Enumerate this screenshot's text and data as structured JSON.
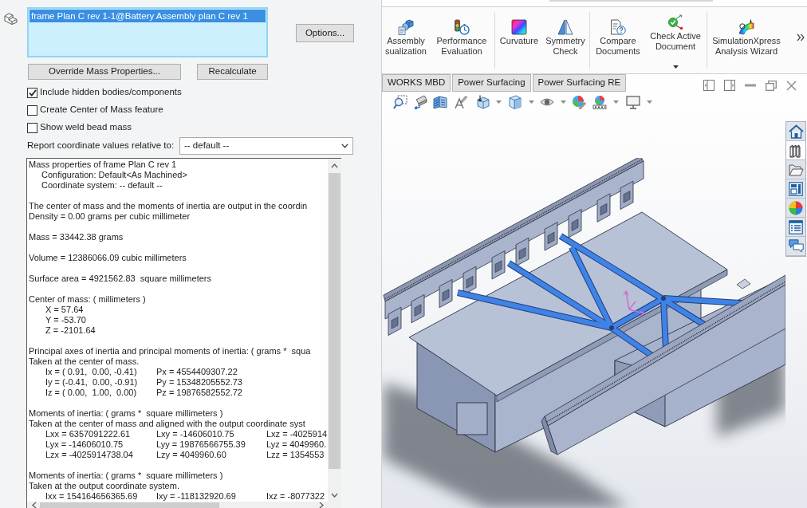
{
  "property_manager": {
    "selection_list": {
      "items": [
        {
          "text": "frame Plan C rev 1-1@Battery Assembly plan C rev 1",
          "selected": true
        }
      ]
    },
    "options_button": "Options...",
    "buttons": [
      "Override Mass Properties...",
      "Recalculate"
    ],
    "checkboxes": [
      {
        "label": "Include hidden bodies/components",
        "checked": true
      },
      {
        "label": "Create Center of Mass feature",
        "checked": false
      },
      {
        "label": "Show weld bead mass",
        "checked": false
      }
    ],
    "coordinate_select": {
      "label": "Report coordinate values relative to:",
      "value": "-- default --"
    },
    "report": {
      "blocks": [
        {
          "lines": [
            {
              "kind": "line",
              "text": "Mass properties of frame Plan C rev 1"
            },
            {
              "kind": "sub",
              "text": "Configuration: Default<As Machined>"
            },
            {
              "kind": "sub",
              "text": "Coordinate system: -- default --"
            }
          ]
        },
        {
          "lines": [
            {
              "kind": "line",
              "text": "The center of mass and the moments of inertia are output in the coordin"
            },
            {
              "kind": "line",
              "text": "Density = 0.00 grams per cubic millimeter"
            }
          ]
        },
        {
          "lines": [
            {
              "kind": "line",
              "text": "Mass = 33442.38 grams"
            }
          ]
        },
        {
          "lines": [
            {
              "kind": "line",
              "text": "Volume = 12386066.09 cubic millimeters"
            }
          ]
        },
        {
          "lines": [
            {
              "kind": "line",
              "text": "Surface area = 4921562.83  square millimeters"
            }
          ]
        },
        {
          "lines": [
            {
              "kind": "line",
              "text": "Center of mass: ( millimeters )"
            },
            {
              "kind": "cells",
              "cells": [
                "X = 57.64"
              ]
            },
            {
              "kind": "cells",
              "cells": [
                "Y = -53.70"
              ]
            },
            {
              "kind": "cells",
              "cells": [
                "Z = -2101.64"
              ]
            }
          ]
        },
        {
          "lines": [
            {
              "kind": "line",
              "text": "Principal axes of inertia and principal moments of inertia: ( grams *  squa"
            },
            {
              "kind": "line",
              "text": "Taken at the center of mass."
            },
            {
              "kind": "cells",
              "cells": [
                "Ix = ( 0.91,  0.00, -0.41)",
                "Px = 4554409307.22"
              ]
            },
            {
              "kind": "cells",
              "cells": [
                "Iy = (-0.41,  0.00, -0.91)",
                "Py = 15348205552.73"
              ]
            },
            {
              "kind": "cells",
              "cells": [
                "Iz = ( 0.00,  1.00,  0.00)",
                "Pz = 19876582552.72"
              ]
            }
          ]
        },
        {
          "lines": [
            {
              "kind": "line",
              "text": "Moments of inertia: ( grams *  square millimeters )"
            },
            {
              "kind": "line",
              "text": "Taken at the center of mass and aligned with the output coordinate syst"
            },
            {
              "kind": "cells",
              "cells": [
                "Lxx = 6357091222.61",
                "Lxy = -14606010.75",
                "Lxz = -4025914"
              ]
            },
            {
              "kind": "cells",
              "cells": [
                "Lyx = -14606010.75",
                "Lyy = 19876566755.39",
                "Lyz = 4049960."
              ]
            },
            {
              "kind": "cells",
              "cells": [
                "Lzx = -4025914738.04",
                "Lzy = 4049960.60",
                "Lzz = 1354553"
              ]
            }
          ]
        },
        {
          "lines": [
            {
              "kind": "line",
              "text": "Moments of inertia: ( grams *  square millimeters )"
            },
            {
              "kind": "line",
              "text": "Taken at the output coordinate system."
            },
            {
              "kind": "cells",
              "cells": [
                "Ixx = 154164656365.69",
                "Ixy = -118132920.69",
                "Ixz = -8077322"
              ]
            }
          ]
        }
      ]
    }
  },
  "ribbon": {
    "groups": [
      {
        "commands": [
          {
            "label": [
              "Assembly",
              "sualization"
            ],
            "dropdown": false
          },
          {
            "label": [
              "Performance",
              "Evaluation"
            ],
            "dropdown": false
          }
        ]
      },
      {
        "commands": [
          {
            "label": [
              "Curvature"
            ],
            "dropdown": false
          },
          {
            "label": [
              "Symmetry",
              "Check"
            ],
            "dropdown": false
          }
        ]
      },
      {
        "commands": [
          {
            "label": [
              "Compare",
              "Documents"
            ],
            "dropdown": false
          },
          {
            "label": [
              "Check Active",
              "Document"
            ],
            "dropdown": true
          }
        ]
      },
      {
        "commands": [
          {
            "label": [
              "SimulationXpress",
              "Analysis Wizard"
            ],
            "dropdown": false
          }
        ]
      }
    ]
  },
  "document_tabs": [
    {
      "label": "WORKS MBD",
      "selected": false
    },
    {
      "label": "Power Surfacing",
      "selected": false
    },
    {
      "label": "Power Surfacing RE",
      "selected": false
    }
  ],
  "task_pane": {
    "tabs": [
      {
        "selected": false
      },
      {
        "selected": true
      },
      {
        "selected": false
      },
      {
        "selected": false
      },
      {
        "selected": false
      },
      {
        "selected": false
      },
      {
        "selected": false
      }
    ]
  }
}
